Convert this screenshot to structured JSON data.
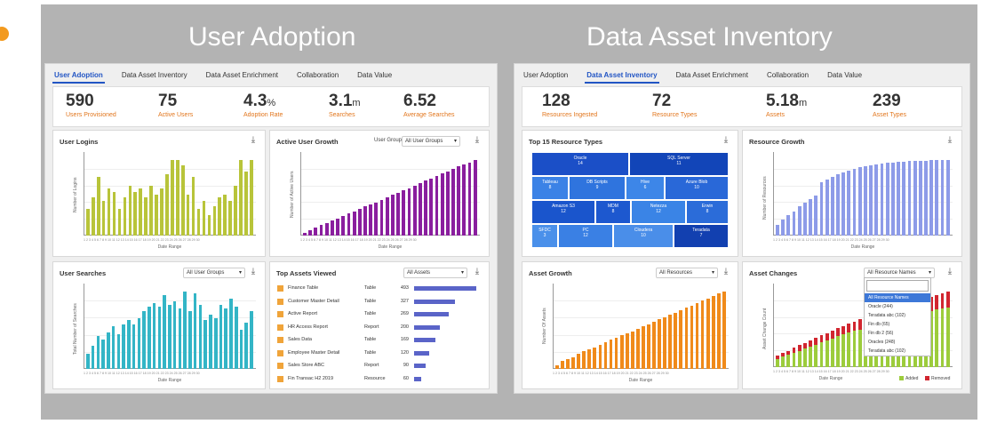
{
  "titles": {
    "left": "User Adoption",
    "right": "Data Asset Inventory"
  },
  "tabs": [
    "User Adoption",
    "Data Asset Inventory",
    "Data Asset Enrichment",
    "Collaboration",
    "Data Value"
  ],
  "left": {
    "active_tab": 0,
    "kpis": [
      {
        "value": "590",
        "unit": "",
        "label": "Users Provisioned"
      },
      {
        "value": "75",
        "unit": "",
        "label": "Active Users"
      },
      {
        "value": "4.3",
        "unit": "%",
        "label": "Adoption Rate"
      },
      {
        "value": "3.1",
        "unit": "m",
        "label": "Searches"
      },
      {
        "value": "6.52",
        "unit": "",
        "label": "Average Searches"
      }
    ],
    "user_logins": {
      "title": "User Logins",
      "xlabel": "Date Range",
      "ylabel": "Number of Logins",
      "color": "#b8c43a",
      "values": [
        90,
        130,
        200,
        120,
        160,
        150,
        90,
        130,
        170,
        150,
        160,
        130,
        170,
        140,
        160,
        210,
        260,
        260,
        240,
        140,
        200,
        90,
        120,
        70,
        100,
        130,
        140,
        120,
        170,
        260,
        220,
        260
      ]
    },
    "active_user_growth": {
      "title": "Active User Growth",
      "filter_label": "User Group",
      "filter_value": "All User Groups",
      "xlabel": "Date Range",
      "ylabel": "Number of Active Users",
      "color": "#8a1e9e",
      "values": [
        10,
        20,
        28,
        38,
        45,
        55,
        62,
        70,
        80,
        88,
        95,
        105,
        112,
        120,
        130,
        140,
        148,
        155,
        165,
        172,
        180,
        190,
        198,
        205,
        215,
        225,
        232,
        240,
        250,
        258,
        265,
        275
      ]
    },
    "user_searches": {
      "title": "User Searches",
      "filter_value": "All User Groups",
      "xlabel": "Date Range",
      "ylabel": "Total Number of Searches",
      "color": "#33b5c6",
      "values": [
        80,
        120,
        170,
        150,
        190,
        220,
        180,
        230,
        250,
        230,
        260,
        300,
        320,
        340,
        320,
        380,
        330,
        350,
        310,
        400,
        300,
        390,
        330,
        250,
        280,
        260,
        330,
        310,
        360,
        320,
        200,
        240,
        300
      ]
    },
    "top_assets": {
      "title": "Top Assets Viewed",
      "filter_value": "All Assets",
      "rows": [
        {
          "name": "Finance Table",
          "type": "Table",
          "value": "493",
          "frac": 1.0
        },
        {
          "name": "Customer Master Detail",
          "type": "Table",
          "value": "327",
          "frac": 0.66
        },
        {
          "name": "Active Report",
          "type": "Table",
          "value": "269",
          "frac": 0.55
        },
        {
          "name": "HR Access Report",
          "type": "Report",
          "value": "200",
          "frac": 0.41
        },
        {
          "name": "Sales Data",
          "type": "Table",
          "value": "169",
          "frac": 0.34
        },
        {
          "name": "Employee Master Detail",
          "type": "Table",
          "value": "120",
          "frac": 0.24
        },
        {
          "name": "Sales Store ABC",
          "type": "Report",
          "value": "90",
          "frac": 0.18
        },
        {
          "name": "Fin Transac H2 2019",
          "type": "Resource",
          "value": "60",
          "frac": 0.12
        }
      ]
    }
  },
  "right": {
    "active_tab": 1,
    "kpis": [
      {
        "value": "128",
        "unit": "",
        "label": "Resources Ingested"
      },
      {
        "value": "72",
        "unit": "",
        "label": "Resource Types"
      },
      {
        "value": "5.18",
        "unit": "m",
        "label": "Assets"
      },
      {
        "value": "239",
        "unit": "",
        "label": "Asset Types"
      }
    ],
    "treemap": {
      "title": "Top 15 Resource Types",
      "cells": [
        {
          "name": "Oracle",
          "value": "14",
          "color": "#1b4fc7"
        },
        {
          "name": "SQL Server",
          "value": "11",
          "color": "#1245b8"
        },
        {
          "name": "Tableau",
          "value": "8",
          "color": "#3b82e6"
        },
        {
          "name": "DB Scripts",
          "value": "9",
          "color": "#2f74de"
        },
        {
          "name": "Hive",
          "value": "6",
          "color": "#3d86e8"
        },
        {
          "name": "Azure Blob",
          "value": "10",
          "color": "#2968d8"
        },
        {
          "name": "Amazon S3",
          "value": "12",
          "color": "#1a55cc"
        },
        {
          "name": "MDM",
          "value": "8",
          "color": "#1d58cf"
        },
        {
          "name": "Netezza",
          "value": "12",
          "color": "#3a84e6"
        },
        {
          "name": "Erwin",
          "value": "8",
          "color": "#2b6cd9"
        },
        {
          "name": "SFDC",
          "value": "3",
          "color": "#4a90ea"
        },
        {
          "name": "PC",
          "value": "12",
          "color": "#3a80e4"
        },
        {
          "name": "Cloudera",
          "value": "10",
          "color": "#4a8ee9"
        },
        {
          "name": "Teradata",
          "value": "7",
          "color": "#1240b0"
        }
      ]
    },
    "resource_growth": {
      "title": "Resource Growth",
      "xlabel": "Date Range",
      "ylabel": "Number of Resources",
      "color": "#8d9be8",
      "values": [
        20,
        30,
        38,
        45,
        55,
        62,
        68,
        75,
        100,
        105,
        110,
        115,
        118,
        122,
        125,
        128,
        130,
        132,
        133,
        135,
        136,
        137,
        138,
        138,
        139,
        139,
        140,
        140,
        141,
        141,
        142,
        142
      ]
    },
    "asset_growth": {
      "title": "Asset Growth",
      "filter_value": "All Resources",
      "xlabel": "Date Range",
      "ylabel": "Number Of Assets",
      "color": "#f08a1a",
      "values": [
        10,
        20,
        25,
        30,
        38,
        45,
        50,
        55,
        62,
        68,
        74,
        80,
        86,
        90,
        96,
        102,
        108,
        114,
        120,
        126,
        132,
        138,
        144,
        150,
        156,
        162,
        168,
        174,
        180,
        186,
        192,
        198
      ]
    },
    "asset_changes": {
      "title": "Asset Changes",
      "filter_value": "All Resource Names",
      "xlabel": "Date Range",
      "ylabel": "Asset Change Count",
      "legend_added": "Added",
      "legend_removed": "Removed",
      "added": [
        20,
        25,
        30,
        35,
        40,
        45,
        50,
        55,
        60,
        65,
        70,
        75,
        80,
        85,
        88,
        92,
        95,
        100,
        105,
        110,
        115,
        118,
        122,
        125,
        128,
        130,
        132,
        134,
        136,
        140,
        142,
        145
      ],
      "removed": [
        8,
        10,
        10,
        12,
        14,
        14,
        15,
        16,
        17,
        18,
        18,
        20,
        20,
        22,
        22,
        24,
        24,
        25,
        26,
        27,
        28,
        28,
        29,
        30,
        30,
        31,
        32,
        33,
        34,
        36,
        38,
        40
      ],
      "dropdown": [
        "",
        "All Resource Names",
        "Oracle (244)",
        "Teradata abc (102)",
        "Fin db (65)",
        "Fin db 2 (56)",
        "Oracles (248)",
        "Teradata abc (102)"
      ]
    }
  },
  "download_glyph": "⤓",
  "caret": "▾",
  "date_ticks": "1 2 3 4 5 6 7 8 9 10 11 12 13 14 15 16 17 18 19 20 21 22 23 24 25 26 27 28 29 30"
}
